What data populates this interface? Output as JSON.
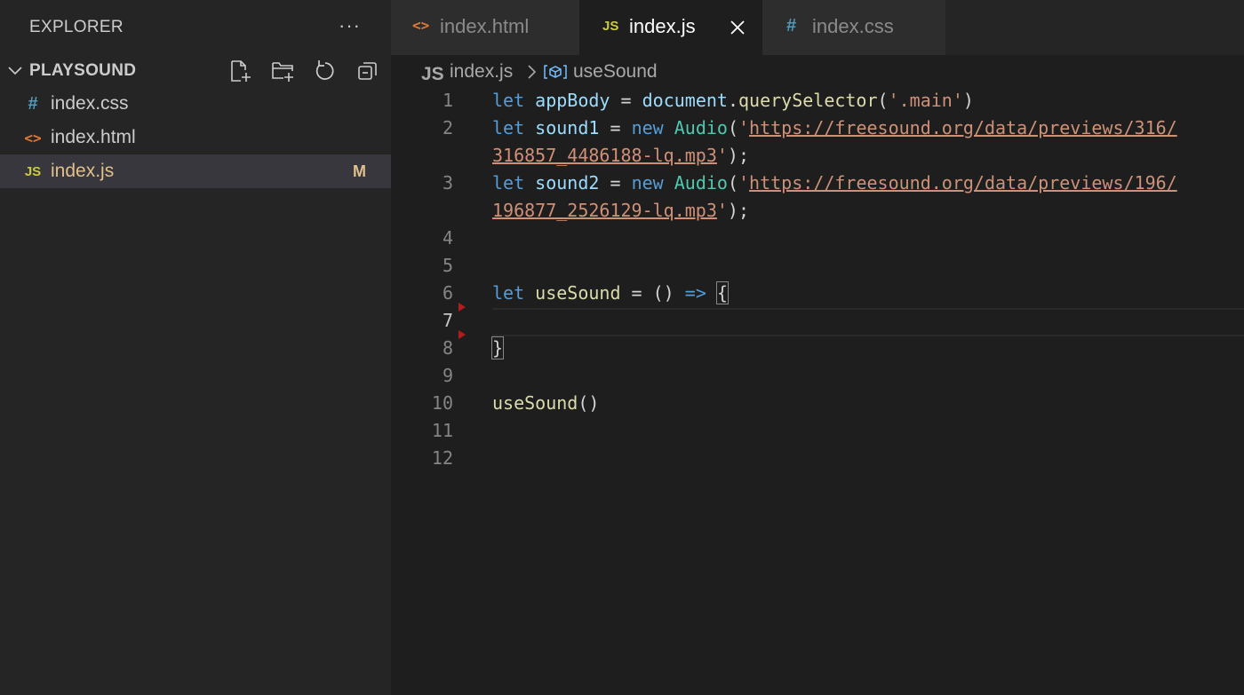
{
  "sidebar": {
    "title": "EXPLORER",
    "more_label": "···",
    "folder_name": "PLAYSOUND",
    "files": [
      {
        "name": "index.css",
        "icon": "#",
        "icon_type": "css"
      },
      {
        "name": "index.html",
        "icon": "<>",
        "icon_type": "html"
      },
      {
        "name": "index.js",
        "icon": "JS",
        "icon_type": "js",
        "badge": "M"
      }
    ],
    "actions": [
      "new-file-icon",
      "new-folder-icon",
      "refresh-icon",
      "collapse-all-icon"
    ]
  },
  "tabs": [
    {
      "label": "index.html",
      "icon": "<>",
      "icon_type": "html"
    },
    {
      "label": "index.js",
      "icon": "JS",
      "icon_type": "js",
      "active": true
    },
    {
      "label": "index.css",
      "icon": "#",
      "icon_type": "css"
    }
  ],
  "breadcrumb": {
    "file_icon": "JS",
    "file": "index.js",
    "separator": ">",
    "symbol_icon": "symbol-variable-icon",
    "symbol": "useSound"
  },
  "editor": {
    "current_line": 7,
    "line_numbers": [
      "1",
      "2",
      "3",
      "4",
      "5",
      "6",
      "7",
      "8",
      "9",
      "10",
      "11",
      "12"
    ],
    "code": {
      "l1": [
        "let",
        "appBody",
        "=",
        "document",
        ".",
        "querySelector",
        "(",
        "'.main'",
        ")"
      ],
      "l2a": [
        "let",
        "sound1",
        "=",
        "new",
        "Audio",
        "(",
        "'",
        "https://freesound.org/data/previews/316/"
      ],
      "l2b": [
        "316857_4486188-lq.mp3",
        "'",
        ");"
      ],
      "l3a": [
        "let",
        "sound2",
        "=",
        "new",
        "Audio",
        "(",
        "'",
        "https://freesound.org/data/previews/196/"
      ],
      "l3b": [
        "196877_2526129-lq.mp3",
        "'",
        ");"
      ],
      "l6": [
        "let",
        "useSound",
        "=",
        "()",
        "=>",
        "{"
      ],
      "l8": [
        "}"
      ],
      "l10": [
        "useSound",
        "()"
      ]
    }
  },
  "colors": {
    "keyword": "#569cd6",
    "variable": "#9cdcfe",
    "function": "#dcdcaa",
    "class": "#4ec9b0",
    "string": "#ce9178",
    "modified_badge": "#e2c08d"
  }
}
